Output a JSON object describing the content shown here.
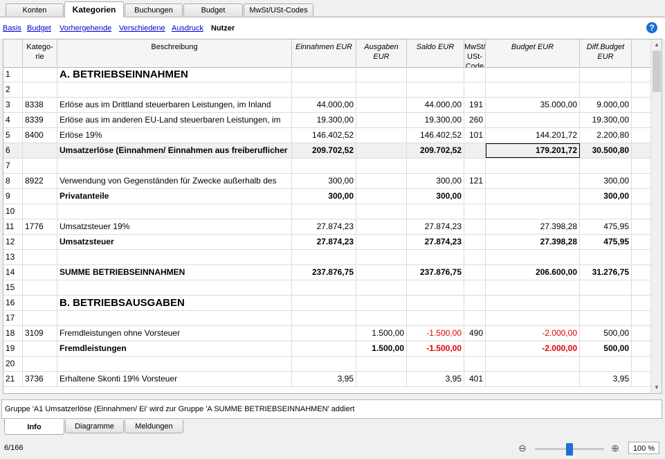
{
  "top_tabs": [
    {
      "label": "Konten",
      "active": false
    },
    {
      "label": "Kategorien",
      "active": true
    },
    {
      "label": "Buchungen",
      "active": false
    },
    {
      "label": "Budget",
      "active": false
    },
    {
      "label": "MwSt/USt-Codes",
      "active": false
    }
  ],
  "views": [
    {
      "label": "Basis",
      "active": false
    },
    {
      "label": "Budget",
      "active": false
    },
    {
      "label": "Vorhergehende",
      "active": false
    },
    {
      "label": "Verschiedene",
      "active": false
    },
    {
      "label": "Ausdruck",
      "active": false
    },
    {
      "label": "Nutzer",
      "active": true
    }
  ],
  "help_icon": "?",
  "columns": [
    {
      "label": "",
      "italic": false
    },
    {
      "label": "Katego-\nrie",
      "italic": false
    },
    {
      "label": "Beschreibung",
      "italic": false
    },
    {
      "label": "Einnahmen EUR",
      "italic": true
    },
    {
      "label": "Ausgaben\nEUR",
      "italic": true
    },
    {
      "label": "Saldo EUR",
      "italic": true
    },
    {
      "label": "MwSt/\nUSt-\nCode",
      "italic": false
    },
    {
      "label": "Budget EUR",
      "italic": true
    },
    {
      "label": "Diff.Budget\nEUR",
      "italic": true
    }
  ],
  "rows": [
    {
      "nr": "1",
      "kat": "",
      "desc": "A. BETRIEBSEINNAHMEN",
      "ein": "",
      "aus": "",
      "saldo": "",
      "code": "",
      "budget": "",
      "diff": "",
      "style": "big"
    },
    {
      "nr": "2",
      "kat": "",
      "desc": "",
      "ein": "",
      "aus": "",
      "saldo": "",
      "code": "",
      "budget": "",
      "diff": "",
      "style": ""
    },
    {
      "nr": "3",
      "kat": "8338",
      "desc": "Erlöse aus im Drittland steuerbaren Leistungen, im Inland",
      "ein": "44.000,00",
      "aus": "",
      "saldo": "44.000,00",
      "code": "191",
      "budget": "35.000,00",
      "diff": "9.000,00",
      "style": ""
    },
    {
      "nr": "4",
      "kat": "8339",
      "desc": "Erlöse aus im anderen EU-Land steuerbaren Leistungen, im",
      "ein": "19.300,00",
      "aus": "",
      "saldo": "19.300,00",
      "code": "260",
      "budget": "",
      "diff": "19.300,00",
      "style": ""
    },
    {
      "nr": "5",
      "kat": "8400",
      "desc": "Erlöse 19%",
      "ein": "146.402,52",
      "aus": "",
      "saldo": "146.402,52",
      "code": "101",
      "budget": "144.201,72",
      "diff": "2.200,80",
      "style": ""
    },
    {
      "nr": "6",
      "kat": "",
      "desc": "Umsatzerlöse (Einnahmen/ Einnahmen aus freiberuflicher",
      "ein": "209.702,52",
      "aus": "",
      "saldo": "209.702,52",
      "code": "",
      "budget": "179.201,72",
      "diff": "30.500,80",
      "style": "bold shade"
    },
    {
      "nr": "7",
      "kat": "",
      "desc": "",
      "ein": "",
      "aus": "",
      "saldo": "",
      "code": "",
      "budget": "",
      "diff": "",
      "style": ""
    },
    {
      "nr": "8",
      "kat": "8922",
      "desc": "Verwendung von Gegenständen für Zwecke außerhalb des",
      "ein": "300,00",
      "aus": "",
      "saldo": "300,00",
      "code": "121",
      "budget": "",
      "diff": "300,00",
      "style": ""
    },
    {
      "nr": "9",
      "kat": "",
      "desc": "Privatanteile",
      "ein": "300,00",
      "aus": "",
      "saldo": "300,00",
      "code": "",
      "budget": "",
      "diff": "300,00",
      "style": "bold"
    },
    {
      "nr": "10",
      "kat": "",
      "desc": "",
      "ein": "",
      "aus": "",
      "saldo": "",
      "code": "",
      "budget": "",
      "diff": "",
      "style": ""
    },
    {
      "nr": "11",
      "kat": "1776",
      "desc": "Umsatzsteuer 19%",
      "ein": "27.874,23",
      "aus": "",
      "saldo": "27.874,23",
      "code": "",
      "budget": "27.398,28",
      "diff": "475,95",
      "style": ""
    },
    {
      "nr": "12",
      "kat": "",
      "desc": "Umsatzsteuer",
      "ein": "27.874,23",
      "aus": "",
      "saldo": "27.874,23",
      "code": "",
      "budget": "27.398,28",
      "diff": "475,95",
      "style": "bold"
    },
    {
      "nr": "13",
      "kat": "",
      "desc": "",
      "ein": "",
      "aus": "",
      "saldo": "",
      "code": "",
      "budget": "",
      "diff": "",
      "style": ""
    },
    {
      "nr": "14",
      "kat": "",
      "desc": "SUMME BETRIEBSEINNAHMEN",
      "ein": "237.876,75",
      "aus": "",
      "saldo": "237.876,75",
      "code": "",
      "budget": "206.600,00",
      "diff": "31.276,75",
      "style": "bold"
    },
    {
      "nr": "15",
      "kat": "",
      "desc": "",
      "ein": "",
      "aus": "",
      "saldo": "",
      "code": "",
      "budget": "",
      "diff": "",
      "style": ""
    },
    {
      "nr": "16",
      "kat": "",
      "desc": "B. BETRIEBSAUSGABEN",
      "ein": "",
      "aus": "",
      "saldo": "",
      "code": "",
      "budget": "",
      "diff": "",
      "style": "big"
    },
    {
      "nr": "17",
      "kat": "",
      "desc": "",
      "ein": "",
      "aus": "",
      "saldo": "",
      "code": "",
      "budget": "",
      "diff": "",
      "style": ""
    },
    {
      "nr": "18",
      "kat": "3109",
      "desc": "Fremdleistungen ohne Vorsteuer",
      "ein": "",
      "aus": "1.500,00",
      "saldo": "-1.500,00",
      "code": "490",
      "budget": "-2.000,00",
      "diff": "500,00",
      "style": ""
    },
    {
      "nr": "19",
      "kat": "",
      "desc": "Fremdleistungen",
      "ein": "",
      "aus": "1.500,00",
      "saldo": "-1.500,00",
      "code": "",
      "budget": "-2.000,00",
      "diff": "500,00",
      "style": "bold"
    },
    {
      "nr": "20",
      "kat": "",
      "desc": "",
      "ein": "",
      "aus": "",
      "saldo": "",
      "code": "",
      "budget": "",
      "diff": "",
      "style": ""
    },
    {
      "nr": "21",
      "kat": "3736",
      "desc": "Erhaltene Skonti 19% Vorsteuer",
      "ein": "3,95",
      "aus": "",
      "saldo": "3,95",
      "code": "401",
      "budget": "",
      "diff": "3,95",
      "style": ""
    }
  ],
  "selected_cell": {
    "row": "6",
    "col": "budget"
  },
  "message": "Gruppe 'A1 Umsatzerlöse (Einnahmen/ Ei' wird zur Gruppe 'A SUMME BETRIEBSEINNAHMEN' addiert",
  "bottom_tabs": [
    {
      "label": "Info",
      "active": true
    },
    {
      "label": "Diagramme",
      "active": false
    },
    {
      "label": "Meldungen",
      "active": false
    }
  ],
  "status": {
    "position": "6/166",
    "zoom": "100 %",
    "zoom_fraction": 0.5
  },
  "colors": {
    "negative": "#e00000",
    "accent": "#1d6fd6"
  }
}
